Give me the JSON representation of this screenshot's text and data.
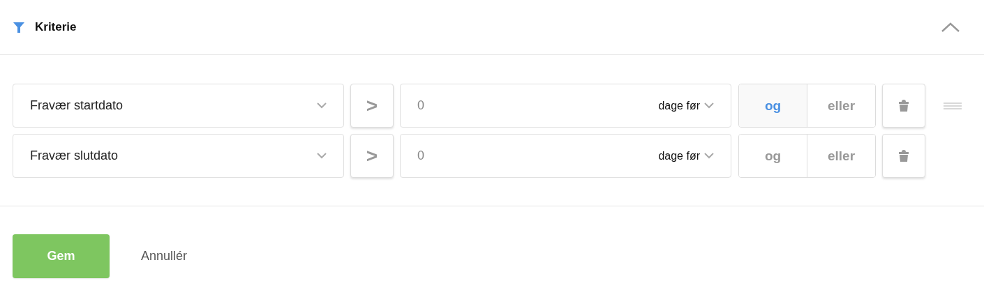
{
  "header": {
    "title": "Kriterie",
    "expanded": true
  },
  "criteria": [
    {
      "field": "Fravær startdato",
      "operator": ">",
      "value": "0",
      "unit": "dage før",
      "conjunctions": [
        {
          "label": "og",
          "selected": true
        },
        {
          "label": "eller",
          "selected": false
        }
      ],
      "drag_handle": true
    },
    {
      "field": "Fravær slutdato",
      "operator": ">",
      "value": "0",
      "unit": "dage før",
      "conjunctions": [
        {
          "label": "og",
          "selected": false
        },
        {
          "label": "eller",
          "selected": false
        }
      ],
      "drag_handle": false
    }
  ],
  "actions": {
    "save": "Gem",
    "cancel": "Annullér"
  }
}
